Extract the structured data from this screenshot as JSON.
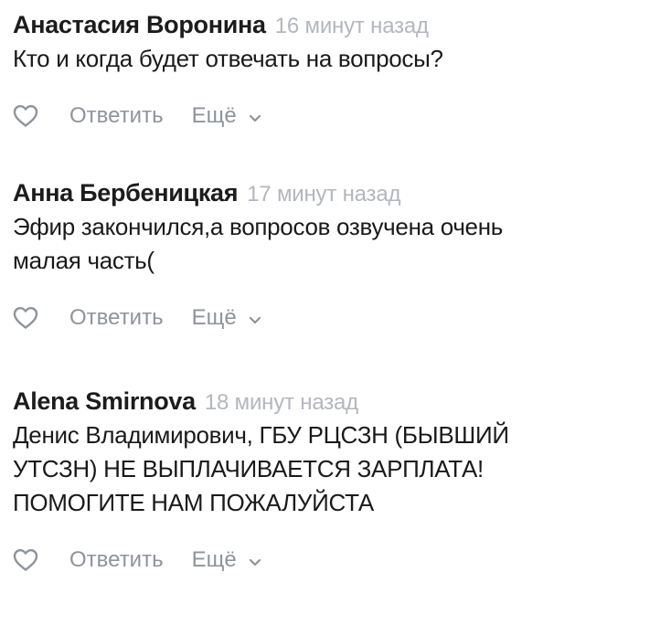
{
  "comments": [
    {
      "author": "Анастасия Воронина",
      "time": "16 минут назад",
      "lines": [
        "Кто и когда будет отвечать на вопросы?"
      ]
    },
    {
      "author": "Анна Бербеницкая",
      "time": "17 минут назад",
      "lines": [
        "Эфир закончился,а вопросов озвучена очень",
        "малая часть("
      ]
    },
    {
      "author": "Alena Smirnova",
      "time": "18 минут назад",
      "lines": [
        "Денис Владимирович, ГБУ РЦСЗН (БЫВШИЙ",
        "УТСЗН) НЕ ВЫПЛАЧИВАЕТСЯ ЗАРПЛАТА!",
        "ПОМОГИТЕ НАМ ПОЖАЛУЙСТА"
      ]
    }
  ],
  "actions": {
    "reply_label": "Ответить",
    "more_label": "Ещё"
  },
  "icons": {
    "like": "heart-icon",
    "more": "chevron-down-icon"
  },
  "colors": {
    "author": "#1c1c1c",
    "time": "#b3b7bd",
    "action": "#8e949c",
    "text": "#1a1a1a"
  }
}
